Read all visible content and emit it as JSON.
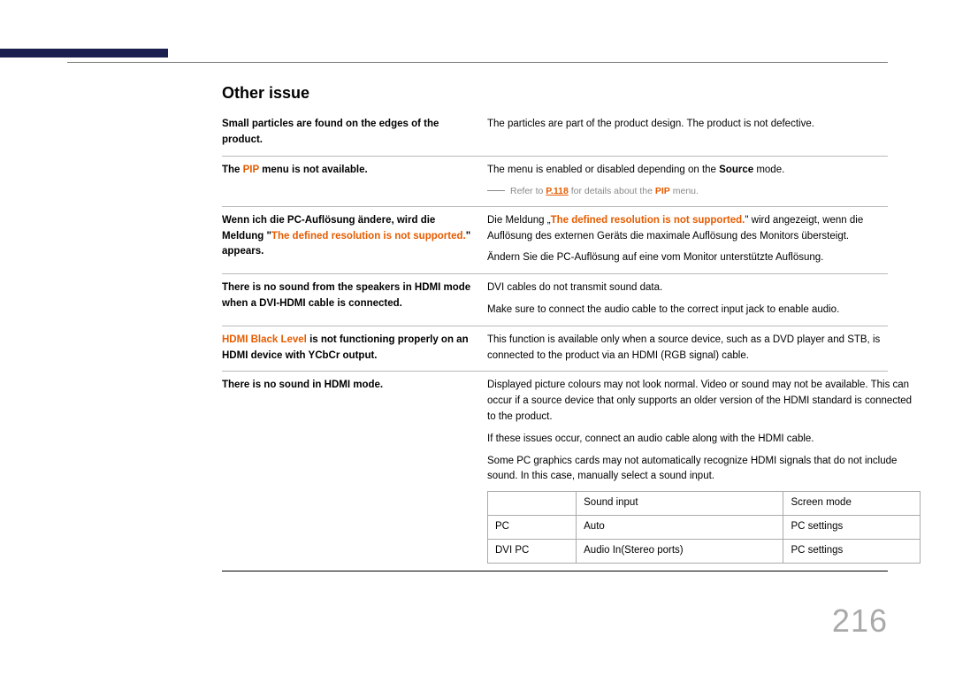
{
  "page_number": "216",
  "heading": "Other issue",
  "rows": {
    "r1": {
      "q": "Small particles are found on the edges of the product.",
      "a": "The particles are part of the product design. The product is not defective."
    },
    "r2": {
      "q1": "The ",
      "q_highlight": "PIP",
      "q2": " menu is not available.",
      "a1a": "The menu is enabled or disabled depending on the ",
      "a1b": "Source",
      "a1c": " mode.",
      "sub_a": "Refer to ",
      "sub_link": "P.118",
      "sub_b": " for details about the ",
      "sub_hl": "PIP",
      "sub_c": " menu."
    },
    "r3": {
      "q1": "Wenn ich die PC-Auflösung ändere, wird die Meldung \"",
      "q_hl": "The defined resolution is not supported.",
      "q2": "\" appears.",
      "a1a": "Die Meldung „",
      "a1b": "The defined resolution is not supported.",
      "a1c": "\" wird angezeigt, wenn die Auflösung des externen Geräts die maximale Auflösung des Monitors übersteigt.",
      "a2": "Ändern Sie die PC-Auflösung auf eine vom Monitor unterstützte Auflösung."
    },
    "r4": {
      "q": "There is no sound from the speakers in HDMI mode when a DVI-HDMI cable is connected.",
      "a1": "DVI cables do not transmit sound data.",
      "a2": "Make sure to connect the audio cable to the correct input jack to enable audio."
    },
    "r5": {
      "q_hl": "HDMI Black Level",
      "q_rest": " is not functioning properly on an HDMI device with YCbCr output.",
      "a": "This function is available only when a source device, such as a DVD player and STB, is connected to the product via an HDMI (RGB signal) cable."
    },
    "r6": {
      "q": "There is no sound in HDMI mode.",
      "a1": "Displayed picture colours may not look normal. Video or sound may not be available. This can occur if a source device that only supports an older version of the HDMI standard is connected to the product.",
      "a2": "If these issues occur, connect an audio cable along with the HDMI cable.",
      "a3": "Some PC graphics cards may not automatically recognize HDMI signals that do not include sound. In this case, manually select a sound input.",
      "table": {
        "h1": "",
        "h2": "Sound input",
        "h3": "Screen mode",
        "r1c1": "PC",
        "r1c2": "Auto",
        "r1c3": "PC settings",
        "r2c1": "DVI PC",
        "r2c2": "Audio In(Stereo ports)",
        "r2c3": "PC settings"
      }
    }
  }
}
